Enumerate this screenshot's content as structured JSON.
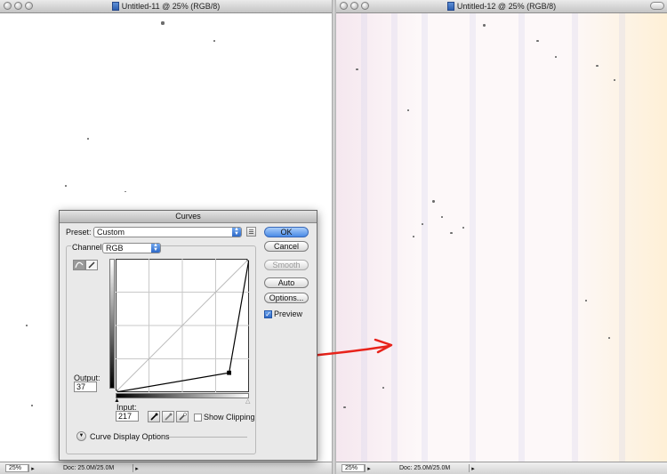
{
  "windows": [
    {
      "title": "Untitled-11 @ 25% (RGB/8)",
      "zoom": "25%",
      "doc_info": "Doc: 25.0M/25.0M"
    },
    {
      "title": "Untitled-12 @ 25% (RGB/8)",
      "zoom": "25%",
      "doc_info": "Doc: 25.0M/25.0M"
    }
  ],
  "curves_dialog": {
    "title": "Curves",
    "preset_label": "Preset:",
    "preset_value": "Custom",
    "channel_label": "Channel:",
    "channel_value": "RGB",
    "output_label": "Output:",
    "output_value": "37",
    "input_label": "Input:",
    "input_value": "217",
    "show_clipping_label": "Show Clipping",
    "show_clipping_checked": false,
    "curve_display_options_label": "Curve Display Options",
    "buttons": {
      "ok": "OK",
      "cancel": "Cancel",
      "smooth": "Smooth",
      "auto": "Auto",
      "options": "Options..."
    },
    "preview_label": "Preview",
    "preview_checked": true,
    "curve_points": [
      {
        "input": 0,
        "output": 0
      },
      {
        "input": 217,
        "output": 37
      },
      {
        "input": 255,
        "output": 255
      }
    ],
    "selected_point_input": 217,
    "selected_point_output": 37
  },
  "annotation": {
    "arrow_color": "#e8231b"
  },
  "colors": {
    "accent_blue": "#4a8ae6",
    "dialog_bg": "#e9e9e9"
  }
}
